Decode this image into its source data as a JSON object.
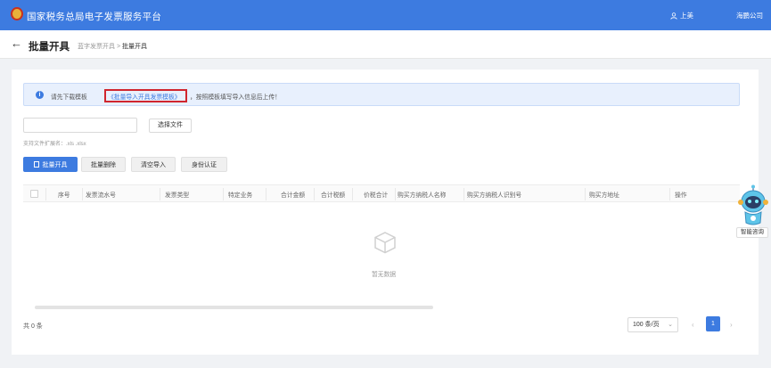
{
  "header": {
    "app_title": "国家税务总局电子发票服务平台",
    "user_name": "上美",
    "company": "海鹏公司"
  },
  "subheader": {
    "title": "批量开具",
    "breadcrumb": [
      "蓝字发票开具",
      "批量开具"
    ],
    "separator": ">"
  },
  "notice": {
    "prefix": "请先下载模板",
    "link": "《批量导入开具发票模板》",
    "suffix": "，按照模板填写导入信息后上传！"
  },
  "upload": {
    "choose_label": "选择文件",
    "hint": "支持文件扩展名：.xls .xlsx"
  },
  "actions": [
    "批量开具",
    "批量删除",
    "清空导入",
    "身份认证"
  ],
  "table": {
    "columns": [
      "序号",
      "发票流水号",
      "发票类型",
      "特定业务",
      "合计金额",
      "合计税额",
      "价税合计",
      "购买方纳税人名称",
      "购买方纳税人识别号",
      "购买方地址",
      "操作"
    ],
    "rows": [],
    "empty_text": "暂无数据"
  },
  "pagination": {
    "total": "共 0 条",
    "page_size": "100 条/页",
    "current_page": "1",
    "prev": "‹",
    "next": "›"
  },
  "assistant": {
    "label": "智能咨询"
  },
  "colors": {
    "primary": "#3d7be0",
    "highlight_border": "#d0262e",
    "notice_bg": "#e8f0fd"
  }
}
